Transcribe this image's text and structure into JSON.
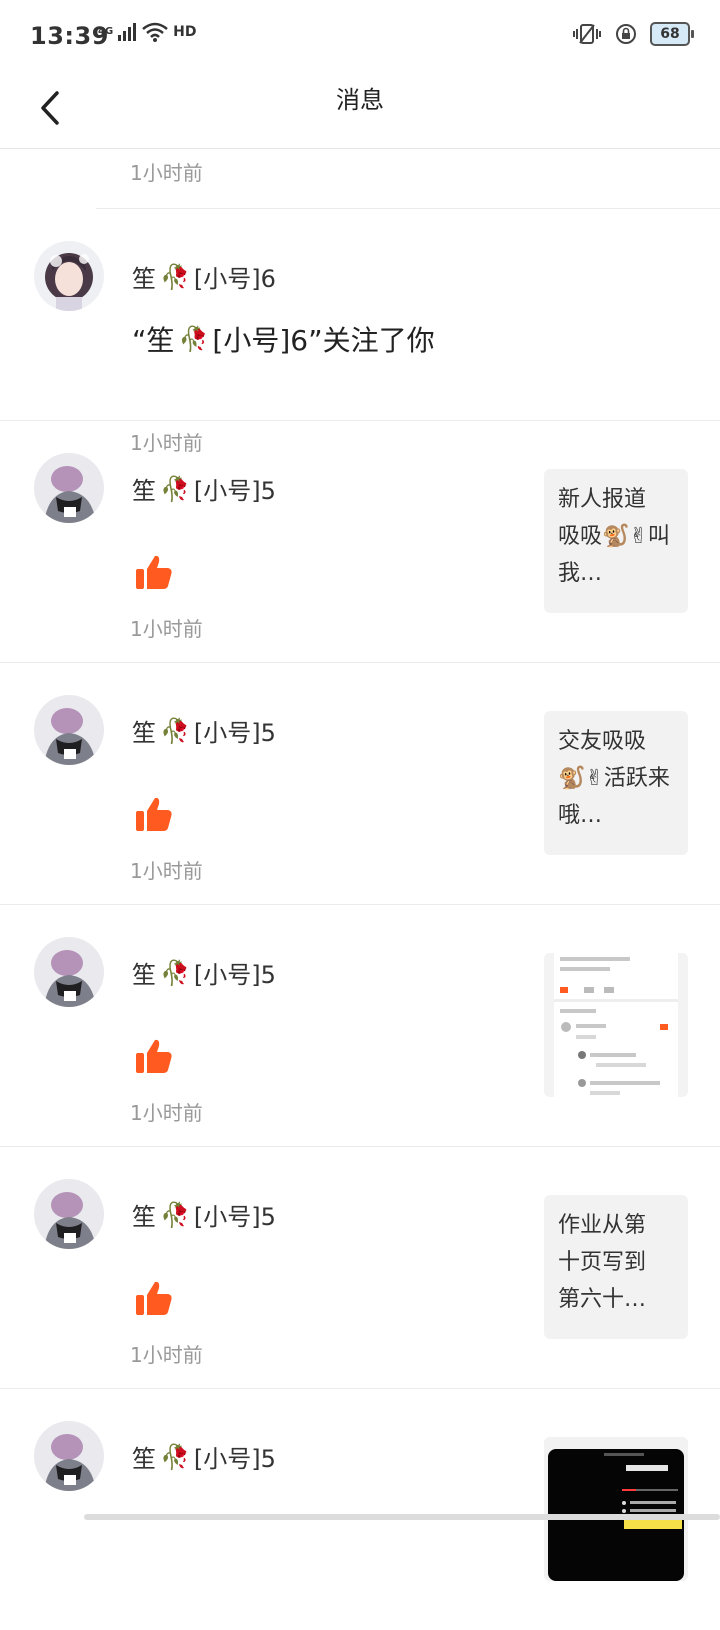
{
  "status_bar": {
    "time": "13:39",
    "network": "4G",
    "hd": "HD",
    "battery": "68",
    "icons": [
      "signal-icon",
      "wifi-icon",
      "vibrate-icon",
      "rotation-lock-icon",
      "battery-icon"
    ]
  },
  "header": {
    "title": "消息",
    "back_icon": "chevron-left-icon"
  },
  "colors": {
    "like": "#ff5a1f",
    "divider": "#ececec",
    "time_text": "#999999",
    "thumb_bg": "#f2f2f2"
  },
  "messages": [
    {
      "type": "partial",
      "time": "1小时前"
    },
    {
      "type": "follow",
      "user": {
        "prefix": "笙",
        "suffix": "[小号]6"
      },
      "message": {
        "open_quote": "“笙",
        "suffix": "[小号]6”关注了你"
      },
      "time": "1小时前"
    },
    {
      "type": "like",
      "user": {
        "prefix": "笙",
        "suffix": "[小号]5"
      },
      "time": "1小时前",
      "thumb_text": "新人报道 吸吸🐒✌叫我…"
    },
    {
      "type": "like",
      "user": {
        "prefix": "笙",
        "suffix": "[小号]5"
      },
      "time": "1小时前",
      "thumb_text": "交友吸吸 🐒✌活跃来哦…"
    },
    {
      "type": "like",
      "user": {
        "prefix": "笙",
        "suffix": "[小号]5"
      },
      "time": "1小时前",
      "thumb_text": ""
    },
    {
      "type": "like",
      "user": {
        "prefix": "笙",
        "suffix": "[小号]5"
      },
      "time": "1小时前",
      "thumb_text": "作业从第 十页写到 第六十…"
    },
    {
      "type": "like",
      "user": {
        "prefix": "笙",
        "suffix": "[小号]5"
      },
      "time": "",
      "thumb_text": ""
    }
  ]
}
